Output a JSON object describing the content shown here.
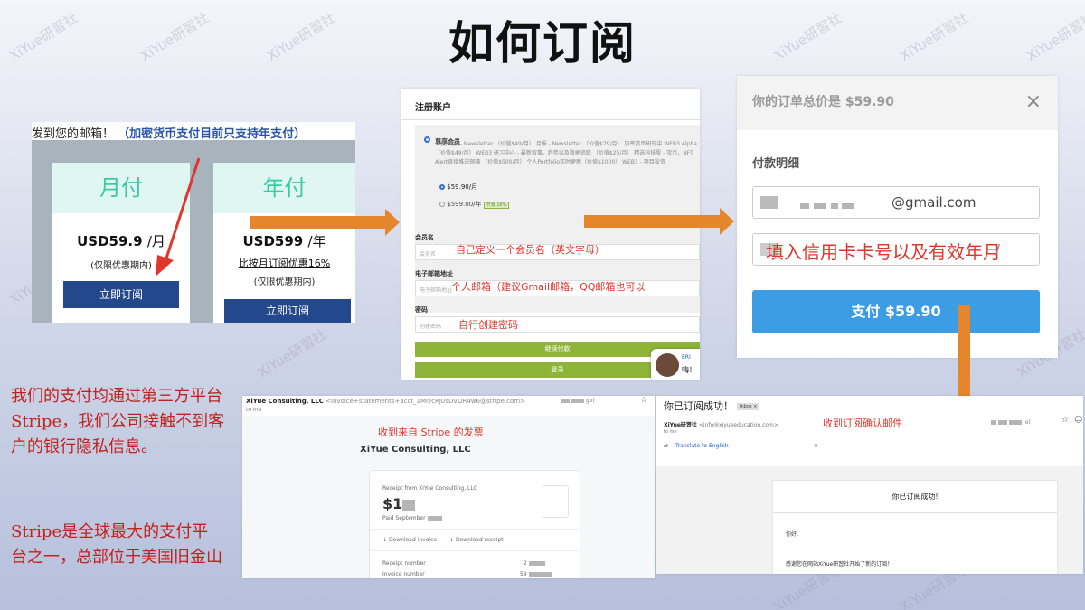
{
  "title": "如何订阅",
  "watermark": "XiYue研習社",
  "pricing_panel": {
    "top_text": "发到您的邮箱！",
    "top_link": "（加密货币支付目前只支持年支付）",
    "plans": [
      {
        "name": "月付",
        "price": "USD59.9",
        "unit": "/月",
        "note": "(仅限优惠期内)",
        "button": "立即订阅"
      },
      {
        "name": "年付",
        "price": "USD599",
        "unit": "/年",
        "discount": "比按月订阅优惠16%",
        "note": "(仅限优惠期内)",
        "button": "立即订阅"
      }
    ]
  },
  "register_panel": {
    "header": "注册账户",
    "membership_label": "尊享会员",
    "membership_desc": "日报/周报 - Newsletter （价值$49/月） 月报 - Newsletter （价值$79/月） 加密货币研究中 WEB3 Alpha（价值$49/月） WEB3 研习中心 - 最新叙事、趋势以及数据追踪 （价值$25/月） 精选科技股 - 货币、NFT Alert直接推送邮箱 （价值$500/月） 个人Portfolio实时更新（价值$1000） WEB3 - 项目投资",
    "option_month": "$59.90/月",
    "option_year": "$599.00/年",
    "save_badge": "节省 16%",
    "username_label": "会员名",
    "username_placeholder": "会员名",
    "username_hint": "自己定义一个会员名（英文字母）",
    "email_label": "电子邮箱地址",
    "email_placeholder": "电子邮箱地址",
    "email_hint": "个人邮箱（建议Gmail邮箱，QQ邮箱也可以",
    "password_label": "密码",
    "password_placeholder": "创建密码",
    "password_hint": "自行创建密码",
    "continue_button": "继续付款",
    "login_button": "登录",
    "chat_name": "ERI",
    "chat_text": "嗨！"
  },
  "payment_panel": {
    "total": "你的订单总价是 $59.90",
    "close": "×",
    "section": "付款明细",
    "email_value": "@gmail.com",
    "card_hint": "填入信用卡卡号以及有效年月",
    "card_suffix": "/",
    "pay_button": "支付 $59.90"
  },
  "left_text": {
    "para1": "我们的支付均通过第三方平台Stripe，我们公司接触不到客户的银行隐私信息。",
    "para2": "Stripe是全球最大的支付平台之一，总部位于美国旧金山"
  },
  "invoice_panel": {
    "from": "XiYue Consulting, LLC",
    "from_addr": "<invoice+statements+acct_1MlycRJ0sDVOR4w6@stripe.com>",
    "time_suffix": "go)",
    "to_me": "to me",
    "hint": "收到来自 Stripe 的发票",
    "company": "XiYue Consulting, LLC",
    "receipt_from": "Receipt from XiYue Consulting, LLC",
    "amount_prefix": "$1",
    "paid": "Paid September",
    "download_invoice": "Download invoice",
    "download_receipt": "Download receipt",
    "receipt_number": "Receipt number",
    "invoice_number": "Invoice number",
    "number_prefix_1": "2",
    "number_prefix_2": "59"
  },
  "confirm_panel": {
    "subject": "你已订阅成功！",
    "inbox": "Inbox ×",
    "sender": "XiYue研習社",
    "sender_addr": "<info@xiyueeducation.com>",
    "time_suffix": ",o)",
    "to_me": "to me",
    "hint": "收到订阅确认邮件",
    "translate": "Translate to English",
    "card_title": "你已订阅成功!",
    "greeting": "你好,",
    "body": "感谢您在网站XiYue研習社开始了新的订阅！"
  }
}
